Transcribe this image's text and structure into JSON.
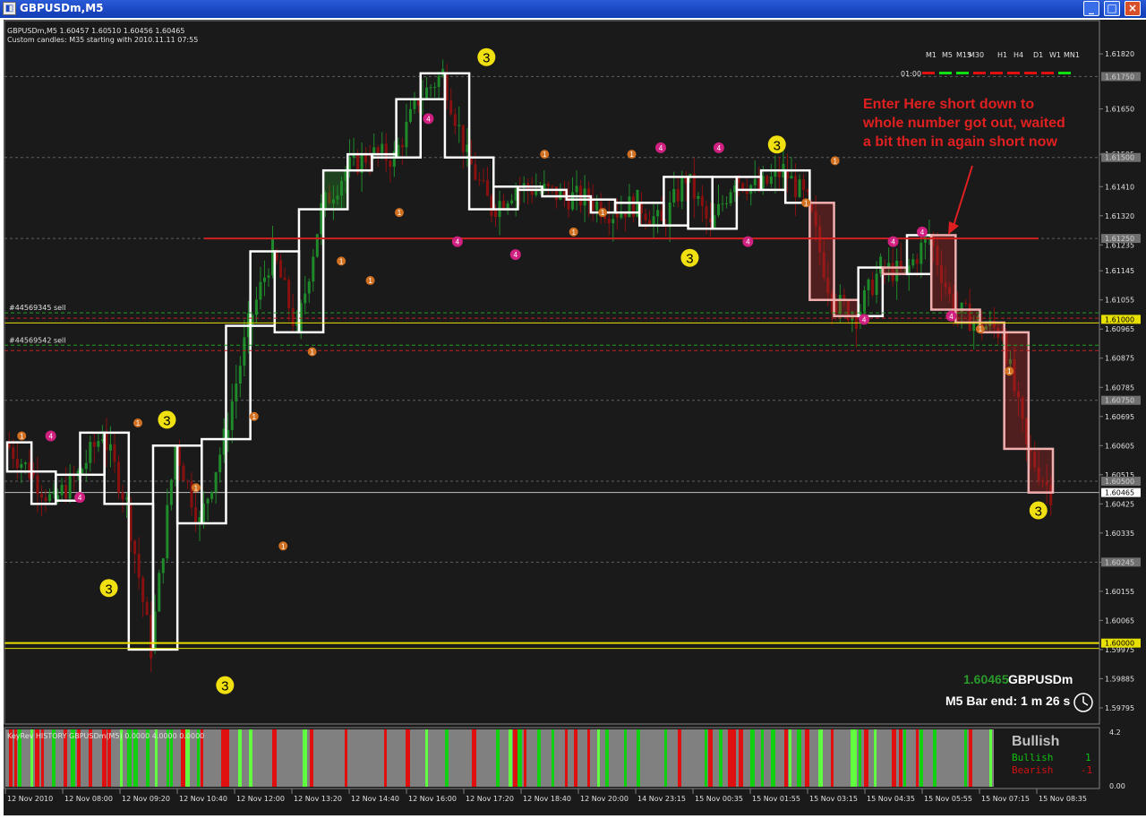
{
  "window": {
    "title": "GBPUSDm,M5",
    "buttons": [
      "_",
      "□",
      "×"
    ]
  },
  "chart_header": {
    "line1": "GBPUSDm,M5  1.60457 1.60510 1.60456 1.60465",
    "line2": "Custom candles: M35 starting with 2010.11.11 07:55"
  },
  "timeframes": {
    "labels": [
      "M1",
      "M5",
      "M15",
      "M30",
      "H1",
      "H4",
      "D1",
      "W1",
      "MN1"
    ],
    "row_label": "01:00",
    "signals": [
      "red",
      "green",
      "green",
      "red",
      "red",
      "red",
      "red",
      "red",
      "green"
    ]
  },
  "annotation": {
    "lines": [
      "Enter Here short down to",
      "whole number got out, waited",
      "a bit then in again short now"
    ]
  },
  "orders": [
    {
      "label": "#44569345 sell",
      "price": 1.6102
    },
    {
      "label": "#44569542 sell",
      "price": 1.6092
    }
  ],
  "price_box": {
    "price": "1.60465",
    "symbol": "GBPUSDm",
    "bar_end": "M5 Bar end: 1 m 26 s"
  },
  "indicator": {
    "header": "KeyRev HISTORY GBPUSDm(M5) 0.0000 4.0000 0.0000",
    "scale_top": "4.2",
    "scale_bottom": "0.00",
    "status": "Bullish",
    "rows": [
      {
        "label": "Bullish",
        "value": "1"
      },
      {
        "label": "Bearish",
        "value": "-1"
      }
    ]
  },
  "colors": {
    "background": "#1a1a1a",
    "bull_candle": "#1e8a2a",
    "bear_candle": "#8a1010",
    "box": "#ffffff",
    "resistance": "#d02020",
    "support": "#e8e000",
    "annotation": "#e02020"
  },
  "chart_data": {
    "type": "candlestick",
    "symbol": "GBPUSDm",
    "timeframe": "M5",
    "ylim": [
      1.5975,
      1.6192
    ],
    "y_ticks": [
      1.6182,
      1.6165,
      1.6151,
      1.6141,
      1.6132,
      1.6123,
      1.6115,
      1.6106,
      1.6097,
      1.6088,
      1.6079,
      1.607,
      1.6061,
      1.6052,
      1.6043,
      1.6034,
      1.6025,
      1.6016,
      1.6007,
      1.5998,
      1.5989,
      1.598
    ],
    "y_tick_labels": [
      "1.61820",
      "1.61650",
      "1.61505",
      "1.61410",
      "1.61320",
      "1.61235",
      "1.61145",
      "1.61055",
      "1.60965",
      "1.60875",
      "1.60785",
      "1.60695",
      "1.60605",
      "1.60515",
      "1.60425",
      "1.60335",
      "1.60245",
      "1.60155",
      "1.60065",
      "1.59975",
      "1.59885",
      "1.59795"
    ],
    "highlighted_prices": [
      {
        "label": "1.61750",
        "value": 1.6175
      },
      {
        "label": "1.61500",
        "value": 1.615
      },
      {
        "label": "1.61250",
        "value": 1.6125
      },
      {
        "label": "1.61000",
        "value": 1.61,
        "color": "yellow"
      },
      {
        "label": "1.60750",
        "value": 1.6075
      },
      {
        "label": "1.60500",
        "value": 1.605
      },
      {
        "label": "1.60465",
        "value": 1.60465,
        "color": "white"
      },
      {
        "label": "1.60245",
        "value": 1.6025
      },
      {
        "label": "1.60000",
        "value": 1.6,
        "color": "yellow"
      }
    ],
    "x_labels": [
      "12 Nov 2010",
      "12 Nov 08:00",
      "12 Nov 09:20",
      "12 Nov 10:40",
      "12 Nov 12:00",
      "12 Nov 13:20",
      "12 Nov 14:40",
      "12 Nov 16:00",
      "12 Nov 17:20",
      "12 Nov 18:40",
      "12 Nov 20:00",
      "14 Nov 23:15",
      "15 Nov 00:35",
      "15 Nov 01:55",
      "15 Nov 03:15",
      "15 Nov 04:35",
      "15 Nov 05:55",
      "15 Nov 07:15",
      "15 Nov 08:35"
    ],
    "boxes": [
      {
        "o": 1.6062,
        "c": 1.6053
      },
      {
        "o": 1.6053,
        "c": 1.6043
      },
      {
        "o": 1.6044,
        "c": 1.6052
      },
      {
        "o": 1.6052,
        "c": 1.6065
      },
      {
        "o": 1.6065,
        "c": 1.6043
      },
      {
        "o": 1.6043,
        "c": 1.5998
      },
      {
        "o": 1.5998,
        "c": 1.6061
      },
      {
        "o": 1.6061,
        "c": 1.6037
      },
      {
        "o": 1.6037,
        "c": 1.6063
      },
      {
        "o": 1.6063,
        "c": 1.6098
      },
      {
        "o": 1.6098,
        "c": 1.6121
      },
      {
        "o": 1.6121,
        "c": 1.6096
      },
      {
        "o": 1.6096,
        "c": 1.6134
      },
      {
        "o": 1.6134,
        "c": 1.6146
      },
      {
        "o": 1.6146,
        "c": 1.6151
      },
      {
        "o": 1.6151,
        "c": 1.615
      },
      {
        "o": 1.615,
        "c": 1.6168
      },
      {
        "o": 1.6168,
        "c": 1.6176
      },
      {
        "o": 1.6176,
        "c": 1.615
      },
      {
        "o": 1.615,
        "c": 1.6134
      },
      {
        "o": 1.6134,
        "c": 1.6141
      },
      {
        "o": 1.6141,
        "c": 1.614
      },
      {
        "o": 1.614,
        "c": 1.6138
      },
      {
        "o": 1.6138,
        "c": 1.6137
      },
      {
        "o": 1.6137,
        "c": 1.6133
      },
      {
        "o": 1.6133,
        "c": 1.6136
      },
      {
        "o": 1.6136,
        "c": 1.6129
      },
      {
        "o": 1.6129,
        "c": 1.6144
      },
      {
        "o": 1.6144,
        "c": 1.6128
      },
      {
        "o": 1.6128,
        "c": 1.6144
      },
      {
        "o": 1.6144,
        "c": 1.614
      },
      {
        "o": 1.614,
        "c": 1.6146
      },
      {
        "o": 1.6146,
        "c": 1.6136
      },
      {
        "o": 1.6136,
        "c": 1.6106
      },
      {
        "o": 1.6106,
        "c": 1.6101
      },
      {
        "o": 1.6101,
        "c": 1.6116
      },
      {
        "o": 1.6116,
        "c": 1.6114
      },
      {
        "o": 1.6114,
        "c": 1.6126
      },
      {
        "o": 1.6126,
        "c": 1.6103
      },
      {
        "o": 1.6103,
        "c": 1.6099
      },
      {
        "o": 1.6099,
        "c": 1.6096
      },
      {
        "o": 1.6096,
        "c": 1.606
      },
      {
        "o": 1.606,
        "c": 1.60465
      }
    ],
    "markers": [
      {
        "x": 0,
        "y": 1.6064,
        "kind": "1"
      },
      {
        "x": 1,
        "y": 1.6064,
        "kind": "4"
      },
      {
        "x": 2,
        "y": 1.6045,
        "kind": "4"
      },
      {
        "x": 3,
        "y": 1.6017,
        "kind": "3"
      },
      {
        "x": 4,
        "y": 1.6068,
        "kind": "1"
      },
      {
        "x": 5,
        "y": 1.6069,
        "kind": "3"
      },
      {
        "x": 6,
        "y": 1.6048,
        "kind": "1"
      },
      {
        "x": 7,
        "y": 1.5987,
        "kind": "3"
      },
      {
        "x": 8,
        "y": 1.607,
        "kind": "1"
      },
      {
        "x": 9,
        "y": 1.603,
        "kind": "1"
      },
      {
        "x": 10,
        "y": 1.609,
        "kind": "1"
      },
      {
        "x": 11,
        "y": 1.6118,
        "kind": "1"
      },
      {
        "x": 12,
        "y": 1.6112,
        "kind": "1"
      },
      {
        "x": 13,
        "y": 1.6133,
        "kind": "1"
      },
      {
        "x": 14,
        "y": 1.6162,
        "kind": "4"
      },
      {
        "x": 15,
        "y": 1.6124,
        "kind": "4"
      },
      {
        "x": 16,
        "y": 1.6181,
        "kind": "3"
      },
      {
        "x": 17,
        "y": 1.612,
        "kind": "4"
      },
      {
        "x": 18,
        "y": 1.6151,
        "kind": "1"
      },
      {
        "x": 19,
        "y": 1.6127,
        "kind": "1"
      },
      {
        "x": 20,
        "y": 1.6133,
        "kind": "1"
      },
      {
        "x": 21,
        "y": 1.6151,
        "kind": "1"
      },
      {
        "x": 22,
        "y": 1.6153,
        "kind": "4"
      },
      {
        "x": 23,
        "y": 1.6119,
        "kind": "3"
      },
      {
        "x": 24,
        "y": 1.6153,
        "kind": "4"
      },
      {
        "x": 25,
        "y": 1.6124,
        "kind": "4"
      },
      {
        "x": 26,
        "y": 1.6154,
        "kind": "3"
      },
      {
        "x": 27,
        "y": 1.6136,
        "kind": "1"
      },
      {
        "x": 28,
        "y": 1.6149,
        "kind": "1"
      },
      {
        "x": 29,
        "y": 1.61,
        "kind": "4"
      },
      {
        "x": 30,
        "y": 1.6124,
        "kind": "4"
      },
      {
        "x": 31,
        "y": 1.6127,
        "kind": "4"
      },
      {
        "x": 32,
        "y": 1.6101,
        "kind": "4"
      },
      {
        "x": 33,
        "y": 1.6097,
        "kind": "1"
      },
      {
        "x": 34,
        "y": 1.6084,
        "kind": "1"
      },
      {
        "x": 35,
        "y": 1.6041,
        "kind": "3"
      }
    ],
    "levels": [
      {
        "name": "resistance",
        "value": 1.6125
      },
      {
        "name": "support",
        "value": 1.6
      }
    ]
  }
}
